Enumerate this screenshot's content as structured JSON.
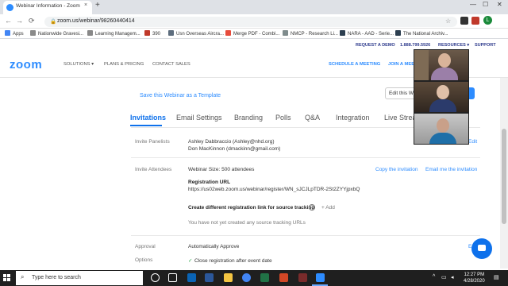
{
  "browser": {
    "tab_title": "Webinar Information - Zoom",
    "tab_close": "×",
    "new_tab": "+",
    "url": "zoom.us/webinar/98260440414",
    "back": "←",
    "forward": "→",
    "reload": "⟳",
    "lock": "🔒",
    "star": "☆",
    "profile_initial": "L",
    "window_controls": [
      "—",
      "☐",
      "✕"
    ]
  },
  "bookmarks": [
    {
      "label": "Apps",
      "color": "#4285f4"
    },
    {
      "label": "Nationwide Gravesi...",
      "color": "#8a8a8a"
    },
    {
      "label": "Learning Managem...",
      "color": "#888888"
    },
    {
      "label": "390",
      "color": "#c0392b"
    },
    {
      "label": "Usn Overseas Aircra...",
      "color": "#5d6d7e"
    },
    {
      "label": "Merge PDF - Combi...",
      "color": "#e74c3c"
    },
    {
      "label": "NMCP - Research Li...",
      "color": "#7f8c8d"
    },
    {
      "label": "NARA - AAD - Serie...",
      "color": "#2c3e50"
    },
    {
      "label": "The National Archiv...",
      "color": "#2c3e50"
    }
  ],
  "zoom_top": {
    "request_demo": "REQUEST A DEMO",
    "phone": "1.888.799.5926",
    "resources": "RESOURCES ▾",
    "support": "SUPPORT"
  },
  "zoom_nav": {
    "logo": "zoom",
    "solutions": "SOLUTIONS ▾",
    "plans": "PLANS & PRICING",
    "contact": "CONTACT SALES",
    "schedule": "SCHEDULE A MEETING",
    "join": "JOIN A MEETING"
  },
  "page": {
    "template_link": "Save this Webinar as a Template",
    "edit_button": "Edit this W",
    "tabs": [
      "Invitations",
      "Email Settings",
      "Branding",
      "Polls",
      "Q&A",
      "Integration",
      "Live Strea"
    ],
    "active_tab": "Invitations",
    "invite_panelists_label": "Invite Panelists",
    "panelists": [
      "Ashley Dabbraccio (Ashley@nhd.org)",
      "Don MacKinnon (dmackinn@gmail.com)"
    ],
    "panelists_edit": "Edit",
    "invite_attendees_label": "Invite Attendees",
    "webinar_size": "Webinar Size: 500 attendees",
    "copy_invitation": "Copy the invitation",
    "email_me": "Email me the invitation",
    "registration_url_label": "Registration URL",
    "registration_url": "https://us02web.zoom.us/webinar/register/WN_sJCJLpTDR-2St2ZYYjpxbQ",
    "source_tracking_label": "Create different registration link for source tracking",
    "source_tracking_help": "?",
    "add_label": "+ Add",
    "no_urls": "You have not yet created any source tracking URLs",
    "approval_label": "Approval",
    "approval_value": "Automatically Approve",
    "approval_edit": "Ed",
    "options_label": "Options",
    "close_reg": "Close registration after event date",
    "check": "✓"
  },
  "taskbar": {
    "search_placeholder": "Type here to search",
    "search_icon": "⌕",
    "time": "12:27 PM",
    "date": "4/28/2020",
    "apps": [
      {
        "name": "cortana-icon",
        "color": "#ffffff"
      },
      {
        "name": "task-view-icon",
        "color": "#ffffff"
      },
      {
        "name": "outlook-icon",
        "color": "#0a64b5"
      },
      {
        "name": "word-icon",
        "color": "#2b579a"
      },
      {
        "name": "file-explorer-icon",
        "color": "#f4c542"
      },
      {
        "name": "excel-icon",
        "color": "#217346"
      },
      {
        "name": "powerpoint-icon",
        "color": "#d24726"
      },
      {
        "name": "zoom-icon",
        "color": "#2d8cff"
      }
    ]
  },
  "colors": {
    "zoom_blue": "#2d8cff",
    "active_tab": "#0e71eb",
    "taskbar": "#1f1f1f"
  }
}
